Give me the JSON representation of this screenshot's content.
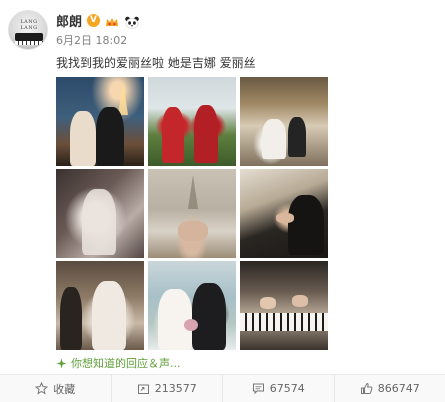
{
  "post": {
    "author": "郎朗",
    "time": "6月2日 18:02",
    "text": "我找到我的爱丽丝啦 她是吉娜 爱丽丝",
    "avatar_label": "LANG LANG"
  },
  "interest_link": "你想知道的回应＆声...",
  "actions": {
    "favorite_label": "收藏",
    "repost_count": "213577",
    "comment_count": "67574",
    "like_count": "866747"
  },
  "colors": {
    "link_green": "#5f9f3a",
    "verified_orange": "#f5a623"
  },
  "icons": [
    "verified-icon",
    "crown-icon",
    "panda-icon",
    "sparkle-icon",
    "star-icon",
    "repost-icon",
    "comment-icon",
    "like-icon"
  ]
}
